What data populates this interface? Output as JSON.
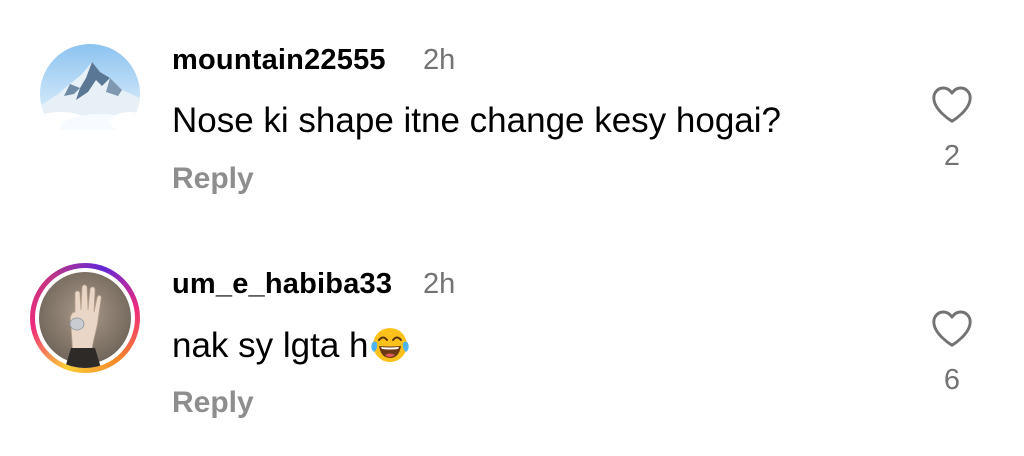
{
  "comments": [
    {
      "username": "mountain22555",
      "time": "2h",
      "text": "Nose ki shape itne change kesy hogai?",
      "reply_label": "Reply",
      "like_count": "2",
      "avatar": "mountain-avatar",
      "has_story_ring": false
    },
    {
      "username": "um_e_habiba33",
      "time": "2h",
      "text": "nak sy lgta h",
      "emoji": "face-with-tears-of-joy",
      "reply_label": "Reply",
      "like_count": "6",
      "avatar": "hand-avatar",
      "has_story_ring": true
    }
  ],
  "colors": {
    "secondary_text": "#737373",
    "reply_text": "#8e8e8e",
    "story_ring": [
      "#f9ce34",
      "#ee2a7b",
      "#6228d7"
    ]
  },
  "icons": {
    "like": "heart-outline-icon"
  }
}
